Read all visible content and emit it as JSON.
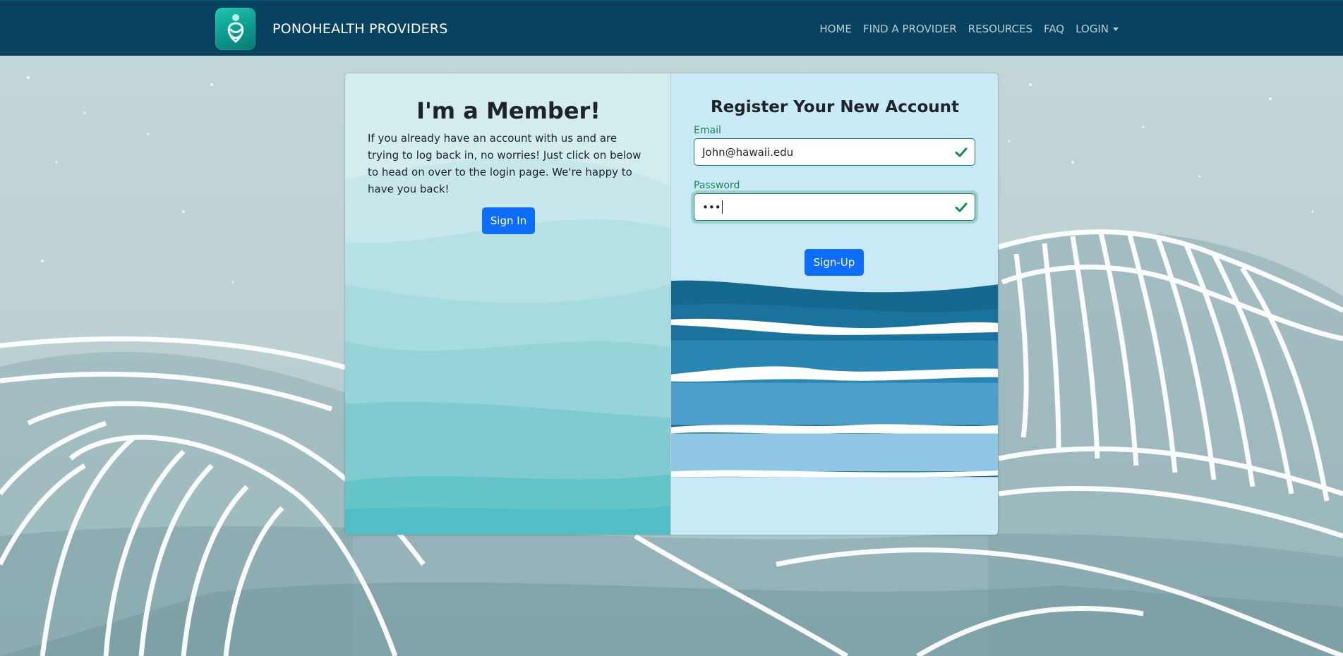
{
  "navbar": {
    "brand": "PONOHEALTH PROVIDERS",
    "links": [
      {
        "label": "HOME"
      },
      {
        "label": "FIND A PROVIDER"
      },
      {
        "label": "RESOURCES"
      },
      {
        "label": "FAQ"
      },
      {
        "label": "LOGIN",
        "dropdown": true
      }
    ]
  },
  "member": {
    "title": "I'm a Member!",
    "text": "If you already have an account with us and are trying to log back in, no worries! Just click on below to head on over to the login page. We're happy to have you back!",
    "button": "Sign In"
  },
  "register": {
    "title": "Register Your New Account",
    "email_label": "Email",
    "email_value": "John@hawaii.edu",
    "password_label": "Password",
    "password_value": "•••",
    "button": "Sign-Up",
    "valid": true
  },
  "colors": {
    "navbar": "#07425f",
    "primary": "#0d6efd",
    "success": "#198754",
    "left_panel": "#d3ecee",
    "right_panel": "#c9e9f6"
  },
  "icons": {
    "logo": "ponohealth-logo-icon",
    "valid": "check-icon",
    "dropdown": "caret-down-icon"
  }
}
